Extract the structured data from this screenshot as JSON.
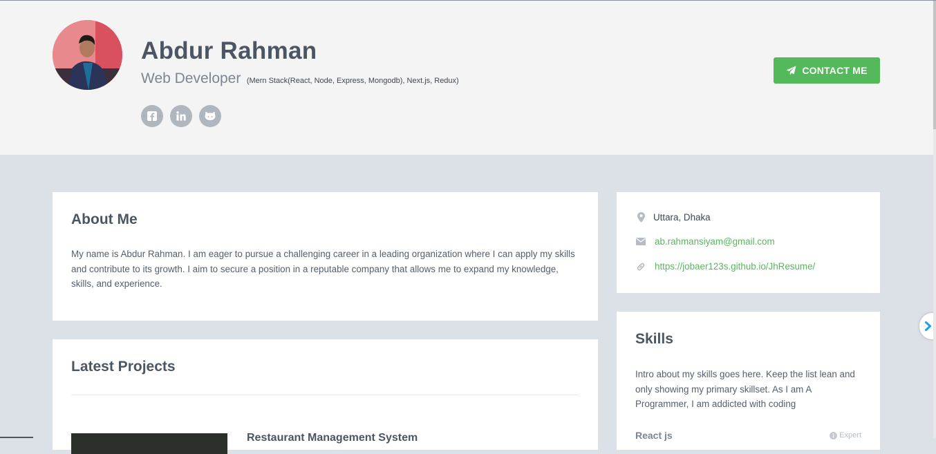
{
  "header": {
    "name": "Abdur Rahman",
    "title": "Web Developer",
    "tagline": "(Mern Stack(React, Node, Express, Mongodb), Next.js, Redux)",
    "socials": [
      {
        "icon": "facebook-icon"
      },
      {
        "icon": "linkedin-icon"
      },
      {
        "icon": "github-icon"
      }
    ],
    "contact_button": "CONTACT ME"
  },
  "about": {
    "heading": "About Me",
    "text": "My name is Abdur Rahman. I am eager to pursue a challenging career in a leading organization where I can apply my skills and contribute to its growth. I aim to secure a position in a reputable company that allows me to expand my knowledge, skills, and experience."
  },
  "projects": {
    "heading": "Latest Projects",
    "items": [
      {
        "title": "Restaurant Management System"
      }
    ]
  },
  "info": {
    "location": "Uttara, Dhaka",
    "email": "ab.rahmansiyam@gmail.com",
    "website": "https://jobaer123s.github.io/JhResume/"
  },
  "skills": {
    "heading": "Skills",
    "intro": "Intro about my skills goes here. Keep the list lean and only showing my primary skillset. As I am A Programmer, I am addicted with coding",
    "items": [
      {
        "name": "React js",
        "level": "Expert"
      }
    ]
  },
  "colors": {
    "accent": "#54b95a",
    "header_bg": "#f4f4f4",
    "page_bg": "#dbe1e6",
    "heading": "#4c5663"
  }
}
